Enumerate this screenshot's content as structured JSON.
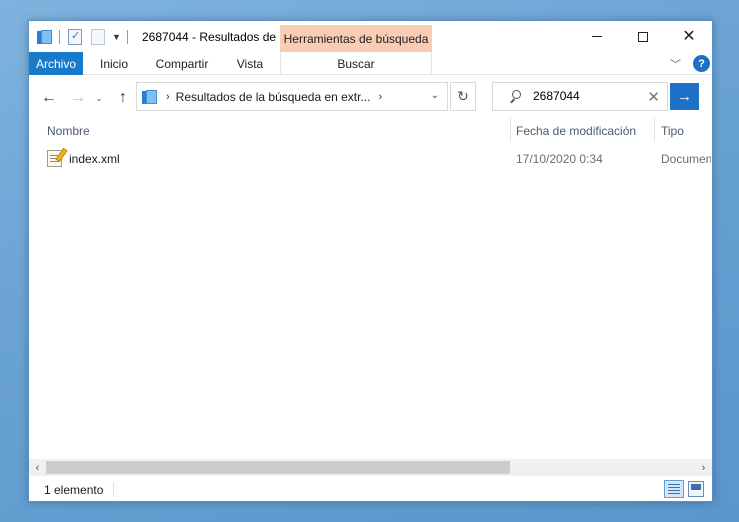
{
  "window": {
    "title": "2687044 - Resultados de ...",
    "context_tab_header": "Herramientas de búsqueda"
  },
  "ribbon": {
    "tabs": [
      "Archivo",
      "Inicio",
      "Compartir",
      "Vista",
      "Buscar"
    ],
    "active_tab": "Archivo",
    "accent_color": "#1979ca",
    "context_color": "#f9cdb3"
  },
  "nav": {
    "breadcrumb": "Resultados de la búsqueda en extr...",
    "search_value": "2687044"
  },
  "columns": [
    "Nombre",
    "Fecha de modificación",
    "Tipo"
  ],
  "files": [
    {
      "name": "index.xml",
      "modified": "17/10/2020 0:34",
      "type": "Documen",
      "icon": "xml-document-icon"
    }
  ],
  "status": {
    "item_count": "1 elemento"
  }
}
